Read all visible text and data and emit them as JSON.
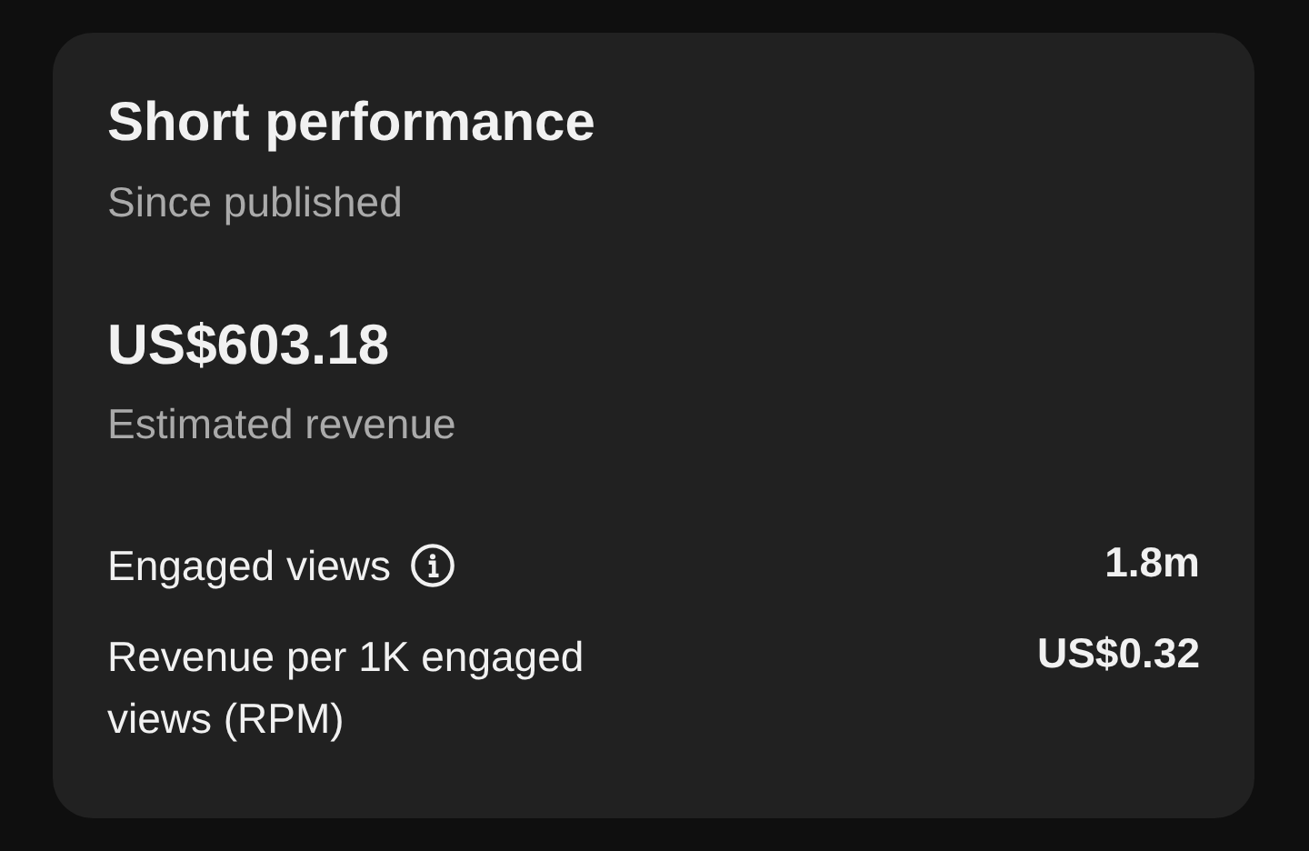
{
  "card": {
    "title": "Short performance",
    "subtitle": "Since published",
    "revenue": {
      "value": "US$603.18",
      "label": "Estimated revenue"
    },
    "metrics": [
      {
        "label": "Engaged views",
        "info": true,
        "value": "1.8m"
      },
      {
        "label": "Revenue per 1K engaged views (RPM)",
        "info": false,
        "value": "US$0.32"
      }
    ]
  }
}
